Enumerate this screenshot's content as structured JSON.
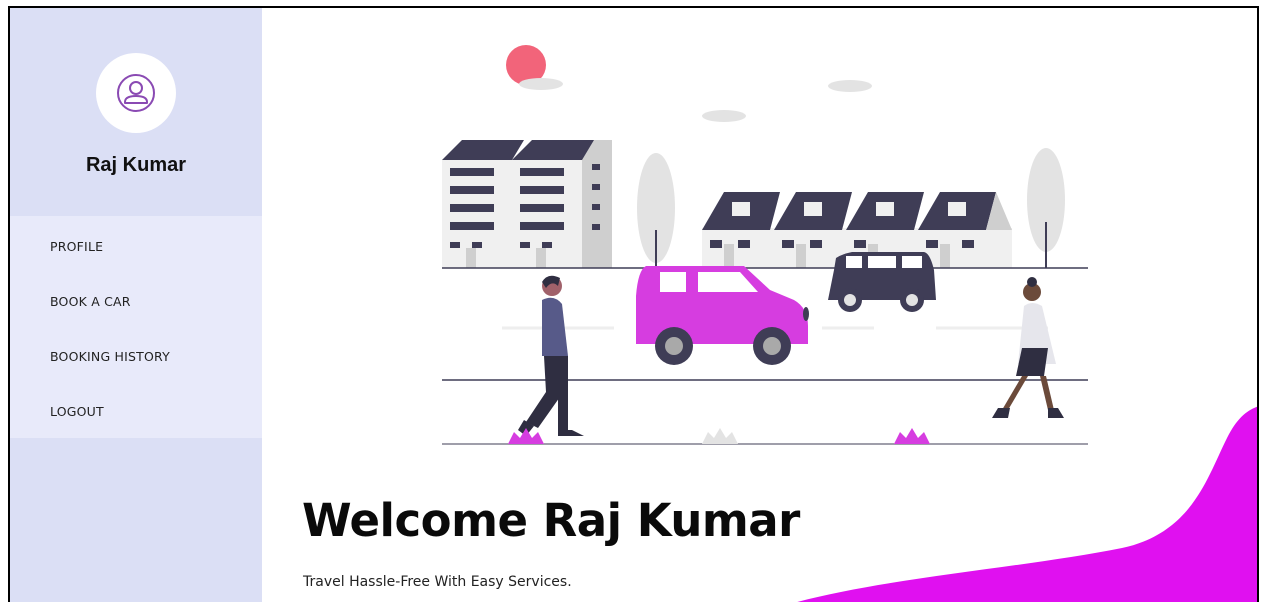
{
  "user": {
    "name": "Raj Kumar"
  },
  "sidebar": {
    "items": [
      {
        "label": "PROFILE"
      },
      {
        "label": "BOOK A CAR"
      },
      {
        "label": "BOOKING HISTORY"
      },
      {
        "label": "LOGOUT"
      }
    ]
  },
  "main": {
    "heading": "Welcome Raj Kumar",
    "tagline": "Travel Hassle-Free With Easy Services."
  },
  "colors": {
    "sidebar_bg": "#dbdff5",
    "nav_bg": "#e8eafa",
    "accent": "#d63de0",
    "wave": "#e010f0",
    "avatar_icon": "#8a4ab3"
  },
  "icons": {
    "avatar": "user-outline-icon"
  }
}
